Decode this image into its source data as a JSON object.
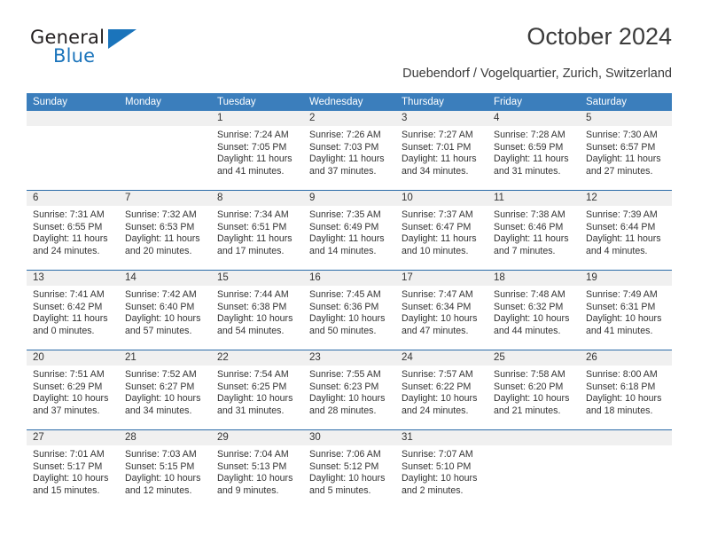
{
  "brand": {
    "name_top": "General",
    "name_bottom": "Blue",
    "accent_color": "#1b74bb",
    "triangle_icon": "triangle-icon"
  },
  "header": {
    "title": "October 2024",
    "subtitle": "Duebendorf / Vogelquartier, Zurich, Switzerland"
  },
  "calendar": {
    "header_color": "#3b7ebc",
    "row_separator_color": "#2b6ca8",
    "day_band_color": "#f0f0f0",
    "weekdays": [
      "Sunday",
      "Monday",
      "Tuesday",
      "Wednesday",
      "Thursday",
      "Friday",
      "Saturday"
    ],
    "weeks": [
      [
        {
          "day": "",
          "lines": []
        },
        {
          "day": "",
          "lines": []
        },
        {
          "day": "1",
          "lines": [
            "Sunrise: 7:24 AM",
            "Sunset: 7:05 PM",
            "Daylight: 11 hours",
            "and 41 minutes."
          ]
        },
        {
          "day": "2",
          "lines": [
            "Sunrise: 7:26 AM",
            "Sunset: 7:03 PM",
            "Daylight: 11 hours",
            "and 37 minutes."
          ]
        },
        {
          "day": "3",
          "lines": [
            "Sunrise: 7:27 AM",
            "Sunset: 7:01 PM",
            "Daylight: 11 hours",
            "and 34 minutes."
          ]
        },
        {
          "day": "4",
          "lines": [
            "Sunrise: 7:28 AM",
            "Sunset: 6:59 PM",
            "Daylight: 11 hours",
            "and 31 minutes."
          ]
        },
        {
          "day": "5",
          "lines": [
            "Sunrise: 7:30 AM",
            "Sunset: 6:57 PM",
            "Daylight: 11 hours",
            "and 27 minutes."
          ]
        }
      ],
      [
        {
          "day": "6",
          "lines": [
            "Sunrise: 7:31 AM",
            "Sunset: 6:55 PM",
            "Daylight: 11 hours",
            "and 24 minutes."
          ]
        },
        {
          "day": "7",
          "lines": [
            "Sunrise: 7:32 AM",
            "Sunset: 6:53 PM",
            "Daylight: 11 hours",
            "and 20 minutes."
          ]
        },
        {
          "day": "8",
          "lines": [
            "Sunrise: 7:34 AM",
            "Sunset: 6:51 PM",
            "Daylight: 11 hours",
            "and 17 minutes."
          ]
        },
        {
          "day": "9",
          "lines": [
            "Sunrise: 7:35 AM",
            "Sunset: 6:49 PM",
            "Daylight: 11 hours",
            "and 14 minutes."
          ]
        },
        {
          "day": "10",
          "lines": [
            "Sunrise: 7:37 AM",
            "Sunset: 6:47 PM",
            "Daylight: 11 hours",
            "and 10 minutes."
          ]
        },
        {
          "day": "11",
          "lines": [
            "Sunrise: 7:38 AM",
            "Sunset: 6:46 PM",
            "Daylight: 11 hours",
            "and 7 minutes."
          ]
        },
        {
          "day": "12",
          "lines": [
            "Sunrise: 7:39 AM",
            "Sunset: 6:44 PM",
            "Daylight: 11 hours",
            "and 4 minutes."
          ]
        }
      ],
      [
        {
          "day": "13",
          "lines": [
            "Sunrise: 7:41 AM",
            "Sunset: 6:42 PM",
            "Daylight: 11 hours",
            "and 0 minutes."
          ]
        },
        {
          "day": "14",
          "lines": [
            "Sunrise: 7:42 AM",
            "Sunset: 6:40 PM",
            "Daylight: 10 hours",
            "and 57 minutes."
          ]
        },
        {
          "day": "15",
          "lines": [
            "Sunrise: 7:44 AM",
            "Sunset: 6:38 PM",
            "Daylight: 10 hours",
            "and 54 minutes."
          ]
        },
        {
          "day": "16",
          "lines": [
            "Sunrise: 7:45 AM",
            "Sunset: 6:36 PM",
            "Daylight: 10 hours",
            "and 50 minutes."
          ]
        },
        {
          "day": "17",
          "lines": [
            "Sunrise: 7:47 AM",
            "Sunset: 6:34 PM",
            "Daylight: 10 hours",
            "and 47 minutes."
          ]
        },
        {
          "day": "18",
          "lines": [
            "Sunrise: 7:48 AM",
            "Sunset: 6:32 PM",
            "Daylight: 10 hours",
            "and 44 minutes."
          ]
        },
        {
          "day": "19",
          "lines": [
            "Sunrise: 7:49 AM",
            "Sunset: 6:31 PM",
            "Daylight: 10 hours",
            "and 41 minutes."
          ]
        }
      ],
      [
        {
          "day": "20",
          "lines": [
            "Sunrise: 7:51 AM",
            "Sunset: 6:29 PM",
            "Daylight: 10 hours",
            "and 37 minutes."
          ]
        },
        {
          "day": "21",
          "lines": [
            "Sunrise: 7:52 AM",
            "Sunset: 6:27 PM",
            "Daylight: 10 hours",
            "and 34 minutes."
          ]
        },
        {
          "day": "22",
          "lines": [
            "Sunrise: 7:54 AM",
            "Sunset: 6:25 PM",
            "Daylight: 10 hours",
            "and 31 minutes."
          ]
        },
        {
          "day": "23",
          "lines": [
            "Sunrise: 7:55 AM",
            "Sunset: 6:23 PM",
            "Daylight: 10 hours",
            "and 28 minutes."
          ]
        },
        {
          "day": "24",
          "lines": [
            "Sunrise: 7:57 AM",
            "Sunset: 6:22 PM",
            "Daylight: 10 hours",
            "and 24 minutes."
          ]
        },
        {
          "day": "25",
          "lines": [
            "Sunrise: 7:58 AM",
            "Sunset: 6:20 PM",
            "Daylight: 10 hours",
            "and 21 minutes."
          ]
        },
        {
          "day": "26",
          "lines": [
            "Sunrise: 8:00 AM",
            "Sunset: 6:18 PM",
            "Daylight: 10 hours",
            "and 18 minutes."
          ]
        }
      ],
      [
        {
          "day": "27",
          "lines": [
            "Sunrise: 7:01 AM",
            "Sunset: 5:17 PM",
            "Daylight: 10 hours",
            "and 15 minutes."
          ]
        },
        {
          "day": "28",
          "lines": [
            "Sunrise: 7:03 AM",
            "Sunset: 5:15 PM",
            "Daylight: 10 hours",
            "and 12 minutes."
          ]
        },
        {
          "day": "29",
          "lines": [
            "Sunrise: 7:04 AM",
            "Sunset: 5:13 PM",
            "Daylight: 10 hours",
            "and 9 minutes."
          ]
        },
        {
          "day": "30",
          "lines": [
            "Sunrise: 7:06 AM",
            "Sunset: 5:12 PM",
            "Daylight: 10 hours",
            "and 5 minutes."
          ]
        },
        {
          "day": "31",
          "lines": [
            "Sunrise: 7:07 AM",
            "Sunset: 5:10 PM",
            "Daylight: 10 hours",
            "and 2 minutes."
          ]
        },
        {
          "day": "",
          "lines": []
        },
        {
          "day": "",
          "lines": []
        }
      ]
    ]
  }
}
